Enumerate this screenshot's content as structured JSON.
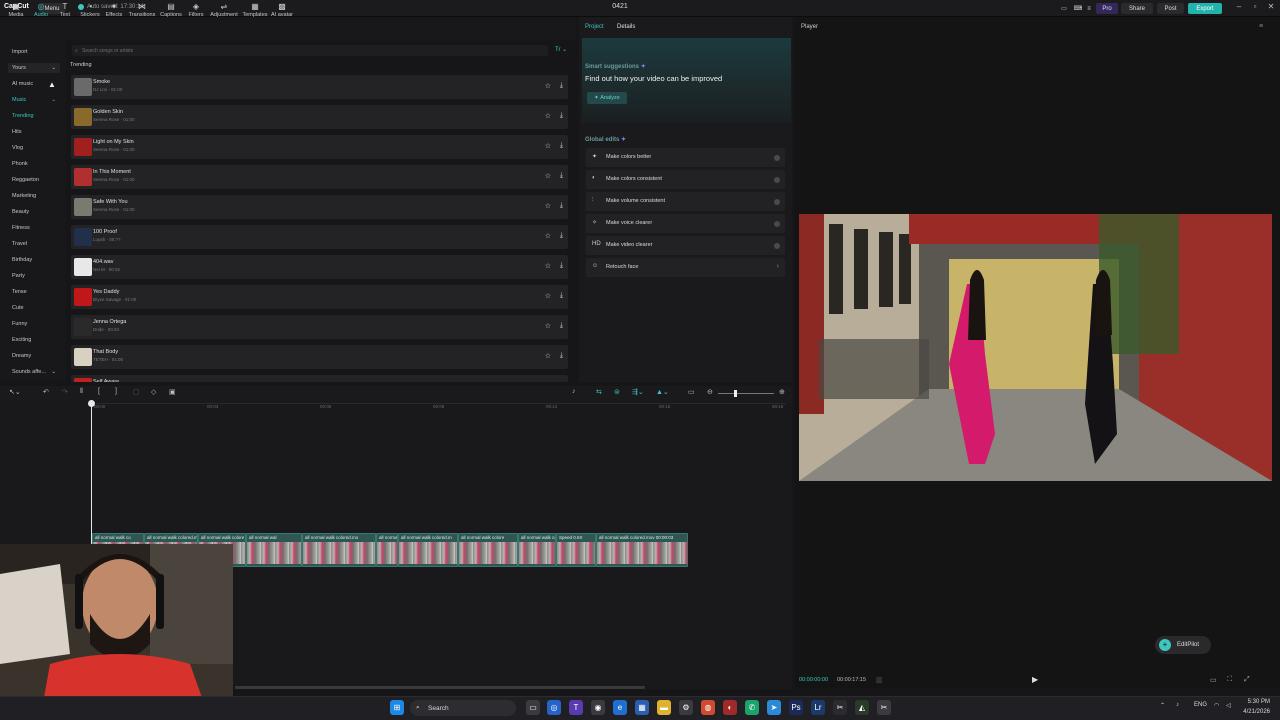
{
  "topbar": {
    "app": "CapCut",
    "menu": "Menu",
    "autosave": "Auto saved: 17:30:14",
    "project": "0421",
    "pro": "Pro",
    "share": "Share",
    "post": "Post",
    "export": "Export"
  },
  "tools": [
    "Media",
    "Audio",
    "Text",
    "Stickers",
    "Effects",
    "Transitions",
    "Captions",
    "Filters",
    "Adjustment",
    "Templates",
    "AI avatar"
  ],
  "side": {
    "import": "Import",
    "yours": "Yours",
    "ai_music": "AI music",
    "music": "Music",
    "sounds": "Sounds affe...",
    "items": [
      "Trending",
      "Hits",
      "Vlog",
      "Phonk",
      "Reggaeton",
      "Marketing",
      "Beauty",
      "Fitness",
      "Travel",
      "Birthday",
      "Party",
      "Tense",
      "Cute",
      "Funny",
      "Exciting",
      "Dreamy"
    ]
  },
  "search": {
    "placeholder": "Search songs or artists",
    "filter": "Tr"
  },
  "library": {
    "heading": "Trending",
    "tracks": [
      {
        "title": "Smoke",
        "sub": "DJ Lmi · 01:00",
        "color": "#6a6a6a"
      },
      {
        "title": "Golden Skin",
        "sub": "Serena Rose · 01:00",
        "color": "#8a6a2a"
      },
      {
        "title": "Light on My Skin",
        "sub": "Serena Rose · 01:00",
        "color": "#a02020"
      },
      {
        "title": "In This Moment",
        "sub": "Serena Rose · 01:00",
        "color": "#b03030"
      },
      {
        "title": "Safe With You",
        "sub": "Serena Rose · 01:00",
        "color": "#7a7a70"
      },
      {
        "title": "100 Proof",
        "sub": "Luyah · 00:??",
        "color": "#20304a"
      },
      {
        "title": "404.wav",
        "sub": "Nei M · 00:32",
        "color": "#e8e8e8"
      },
      {
        "title": "Yes Daddy",
        "sub": "Bryce Savage · 01:00",
        "color": "#c01818"
      },
      {
        "title": "Jenna Ortega",
        "sub": "Dride · 00:34",
        "color": "#2a2a2a"
      },
      {
        "title": "That Body",
        "sub": "TETEH · 01:00",
        "color": "#d8d0c0"
      },
      {
        "title": "Self Aware",
        "sub": "",
        "color": "#c02020"
      }
    ]
  },
  "panel": {
    "tab_project": "Project",
    "tab_details": "Details",
    "sugg_label": "Smart suggestions",
    "sugg_title": "Find out how your video can be improved",
    "analyze": "Analyze",
    "ge_label": "Global edits",
    "edits": [
      {
        "icon": "✦",
        "label": "Make colors better"
      },
      {
        "icon": "◐",
        "label": "Make colors consistent"
      },
      {
        "icon": "⫶",
        "label": "Make volume consistent"
      },
      {
        "icon": "✧",
        "label": "Make voice clearer"
      },
      {
        "icon": "HD",
        "label": "Make video clearer"
      },
      {
        "icon": "☺",
        "label": "Retouch face"
      }
    ]
  },
  "player": {
    "label": "Player",
    "tc_current": "00:00:00:00",
    "tc_total": "00:00:17:15",
    "editpilot": "EditPilot"
  },
  "ruler": [
    "00:00",
    "00:03",
    "00:06",
    "00:09",
    "00:12",
    "00:15",
    "00:18"
  ],
  "clips": [
    {
      "label": "all normal walk co"
    },
    {
      "label": "all normal walk colored.m"
    },
    {
      "label": "all normal walk colore"
    },
    {
      "label": "all normal wal"
    },
    {
      "label": "all normal walk colored.mo"
    },
    {
      "label": "all normal walk colored.mov"
    },
    {
      "label": "all normal walk colored.m"
    },
    {
      "label": "all normal walk colore"
    },
    {
      "label": "all normal walk colored.mov"
    },
    {
      "label": "Speed 0.6X"
    },
    {
      "label": "all normal walk colored.mov  00:00:03"
    }
  ],
  "taskbar": {
    "search": "Search",
    "lang": "ENG",
    "time": "5:30 PM",
    "date": "4/21/2026"
  }
}
